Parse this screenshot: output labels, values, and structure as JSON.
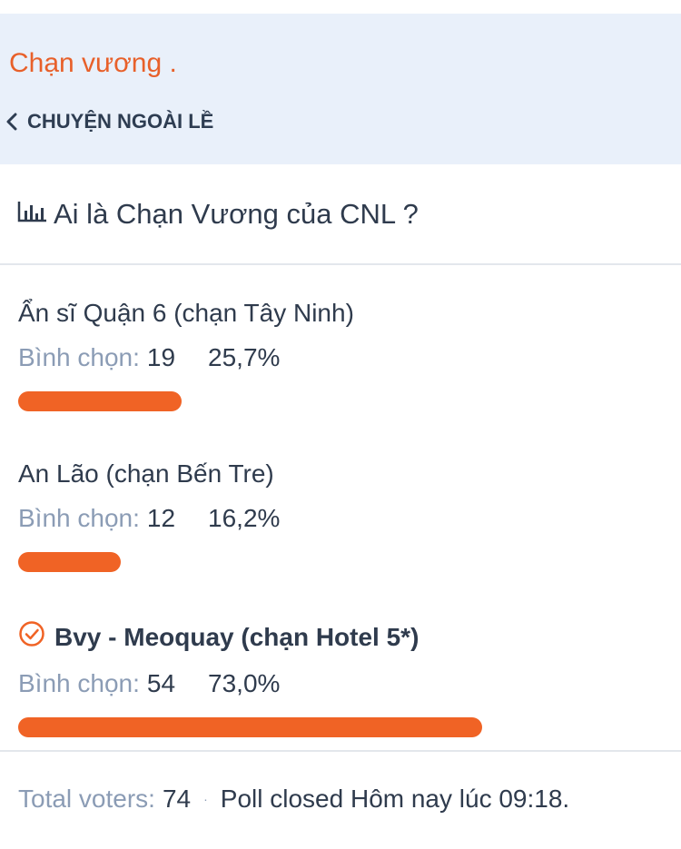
{
  "header": {
    "thread_title": "Chạn vương .",
    "breadcrumb": "CHUYỆN NGOÀI LỀ"
  },
  "poll": {
    "title": "Ai là Chạn Vương của CNL ?",
    "options": [
      {
        "label": "Ẩn sĩ Quận 6 (chạn Tây Ninh)",
        "votes_label": "Bình chọn:",
        "votes": "19",
        "percent": "25,7%",
        "fraction": 0.257,
        "chosen": false
      },
      {
        "label": "An Lão (chạn Bến Tre)",
        "votes_label": "Bình chọn:",
        "votes": "12",
        "percent": "16,2%",
        "fraction": 0.162,
        "chosen": false
      },
      {
        "label": "Bvy - Meoquay (chạn Hotel 5*)",
        "votes_label": "Bình chọn:",
        "votes": "54",
        "percent": "73,0%",
        "fraction": 0.73,
        "chosen": true
      }
    ]
  },
  "footer": {
    "total_label": "Total voters:",
    "total": "74",
    "status": "Poll closed Hôm nay lúc 09:18."
  },
  "colors": {
    "accent": "#f06325",
    "title_orange": "#e8602a",
    "header_bg": "#e9f0fa",
    "muted": "#8b9cb5",
    "text": "#2f3b4d"
  }
}
